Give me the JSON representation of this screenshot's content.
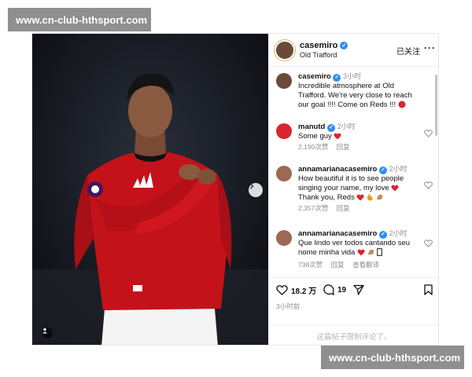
{
  "watermark": {
    "top": "www.cn-club-hthsport.com",
    "bottom": "www.cn-club-hthsport.com"
  },
  "post": {
    "author": "casemiro",
    "location": "Old Trafford",
    "follow_label": "已关注",
    "more_label": "···",
    "caption": {
      "author": "casemiro",
      "time": "3小时",
      "text": "Incredible atmosphere at Old Trafford. We're very close to reach our goal !!!! Come on Reds !!!"
    },
    "comments": [
      {
        "author": "manutd",
        "time": "2小时",
        "text": "Some guy",
        "likes": "2,190次赞",
        "reply": "回复",
        "translate": ""
      },
      {
        "author": "annamarianacasemiro",
        "time": "2小时",
        "text": "How beautiful it is to see people singing your name, my love",
        "text2": "Thank you, Reds",
        "likes": "2,357次赞",
        "reply": "回复",
        "translate": ""
      },
      {
        "author": "annamarianacasemiro",
        "time": "2小时",
        "text": "Que lindo ver todos cantando seu nome minha vida",
        "likes": "738次赞",
        "reply": "回复",
        "translate": "查看翻译"
      }
    ],
    "actions": {
      "like_count": "18.2 万",
      "comment_count": "19"
    },
    "posted_ago": "3小时前",
    "limited_text": "这篇帖子限制评论了。"
  },
  "colors": {
    "jersey": "#c4121a",
    "verified": "#2f8df0",
    "heart": "#d9262e"
  },
  "icons": [
    "verified-icon",
    "heart-icon",
    "comment-icon",
    "share-icon",
    "bookmark-icon",
    "chevron-right-icon",
    "person-tag-icon"
  ]
}
